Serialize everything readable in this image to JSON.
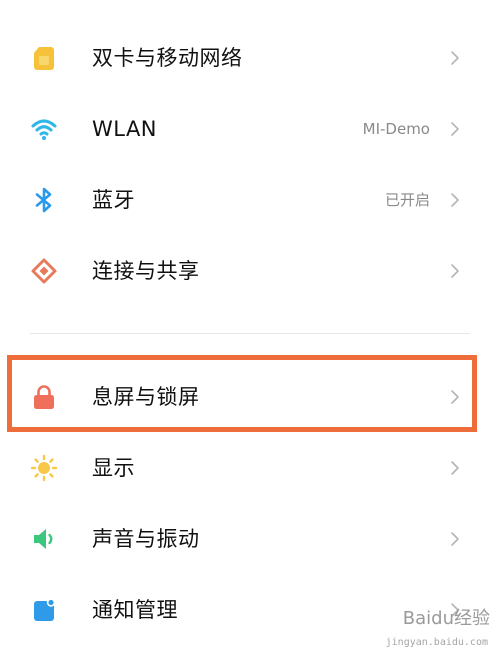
{
  "settings": {
    "items": [
      {
        "label": "双卡与移动网络",
        "value": "",
        "icon": "sim-card-icon"
      },
      {
        "label": "WLAN",
        "value": "MI-Demo",
        "icon": "wifi-icon"
      },
      {
        "label": "蓝牙",
        "value": "已开启",
        "icon": "bluetooth-icon"
      },
      {
        "label": "连接与共享",
        "value": "",
        "icon": "connection-sharing-icon"
      },
      {
        "label": "息屏与锁屏",
        "value": "",
        "icon": "lock-icon"
      },
      {
        "label": "显示",
        "value": "",
        "icon": "sun-icon"
      },
      {
        "label": "声音与振动",
        "value": "",
        "icon": "speaker-icon"
      },
      {
        "label": "通知管理",
        "value": "",
        "icon": "notification-icon"
      }
    ]
  },
  "highlight": {
    "color": "#ee6d3a",
    "target": "息屏与锁屏"
  },
  "watermark": {
    "text": "Baidu经验",
    "sub": "jingyan.baidu.com"
  },
  "colors": {
    "sim": "#f5c23a",
    "wifi": "#2fb7e6",
    "bluetooth": "#2b9ae8",
    "connection": "#e8795a",
    "lock": "#ef6f5b",
    "sun": "#f7c84a",
    "speaker": "#3cc77f",
    "notification": "#2f9ae8"
  }
}
